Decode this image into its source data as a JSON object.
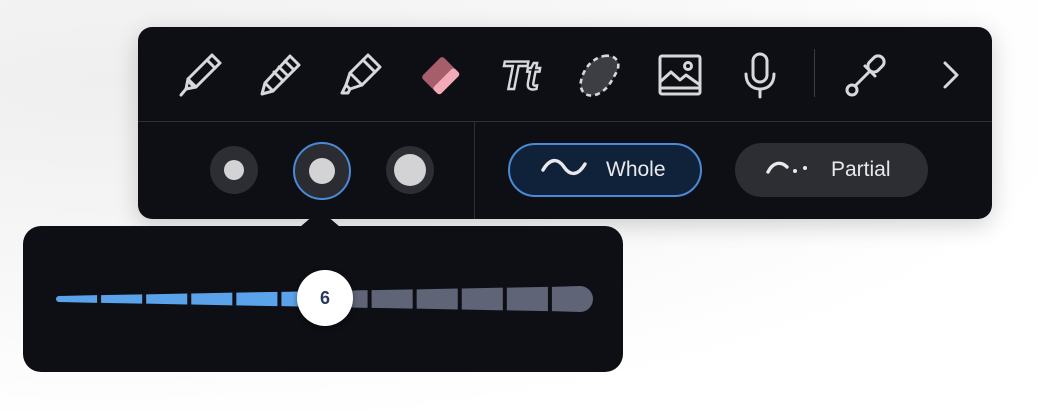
{
  "toolbar": {
    "tools": [
      {
        "icon": "pen-icon",
        "name": "pen"
      },
      {
        "icon": "pencil-icon",
        "name": "pencil"
      },
      {
        "icon": "highlighter-icon",
        "name": "highlighter"
      },
      {
        "icon": "eraser-icon",
        "name": "eraser",
        "color": "#b0606d",
        "selected": true
      },
      {
        "icon": "text-icon",
        "name": "text",
        "label": "Tt"
      },
      {
        "icon": "lasso-icon",
        "name": "lasso"
      },
      {
        "icon": "image-icon",
        "name": "image"
      },
      {
        "icon": "microphone-icon",
        "name": "microphone"
      },
      {
        "icon": "eyedropper-icon",
        "name": "eyedropper"
      },
      {
        "icon": "chevron-right-icon",
        "name": "more"
      }
    ]
  },
  "eraser_options": {
    "sizes": [
      {
        "name": "small",
        "selected": false
      },
      {
        "name": "medium",
        "selected": true
      },
      {
        "name": "large",
        "selected": false
      }
    ],
    "modes": {
      "whole_label": "Whole",
      "partial_label": "Partial",
      "selected": "Whole"
    }
  },
  "size_slider": {
    "value": "6",
    "min": 1,
    "max": 12,
    "active_color": "#5aa2ea",
    "inactive_color": "#5f6577"
  },
  "colors": {
    "panel": "#0d0f14",
    "accent": "#4a8ad6"
  }
}
